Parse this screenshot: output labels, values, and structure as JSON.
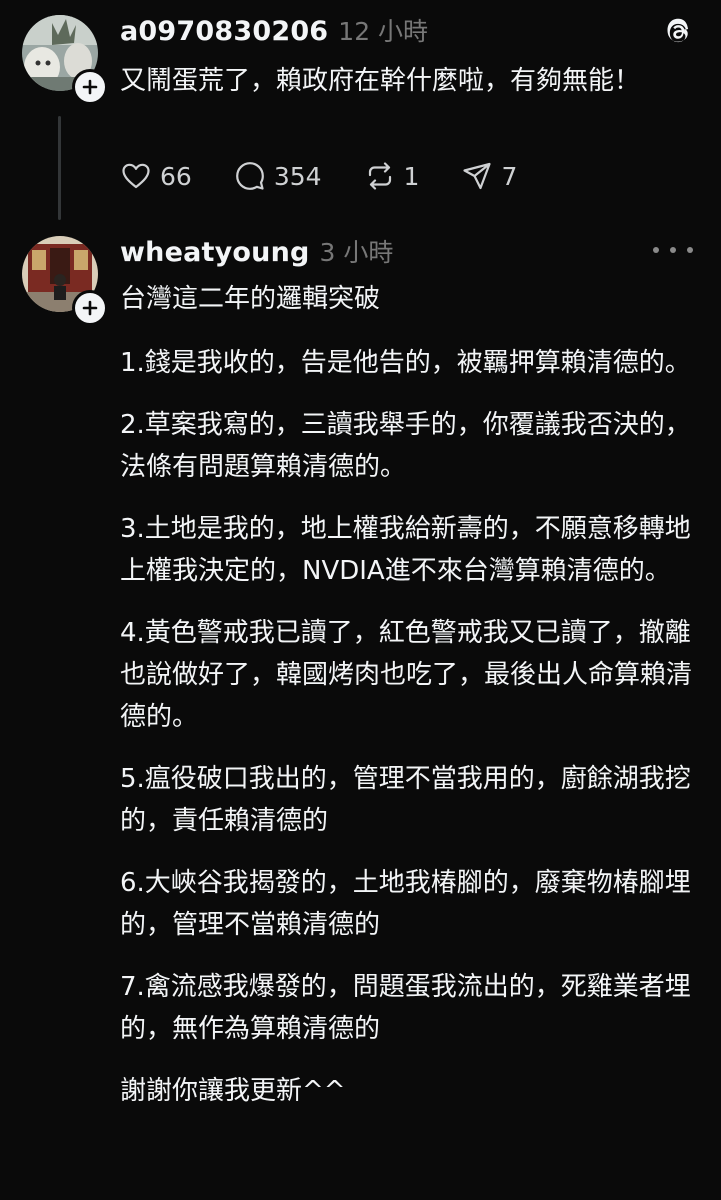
{
  "post1": {
    "username": "a0970830206",
    "timestamp": "12 小時",
    "content": "又鬧蛋荒了，賴政府在幹什麼啦，有夠無能！",
    "actions": {
      "like_count": "66",
      "reply_count": "354",
      "repost_count": "1",
      "share_count": "7"
    },
    "icons": [
      "threads-logo-icon",
      "heart-icon",
      "comment-icon",
      "repost-icon",
      "share-icon",
      "plus-icon"
    ]
  },
  "post2": {
    "username": "wheatyoung",
    "timestamp": "3 小時",
    "paragraphs": [
      "台灣這二年的邏輯突破",
      "1.錢是我收的，告是他告的，被羈押算賴清德的。",
      "2.草案我寫的，三讀我舉手的，你覆議我否決的，法條有問題算賴清德的。",
      "3.土地是我的，地上權我給新壽的，不願意移轉地上權我決定的，NVDIA進不來台灣算賴清德的。",
      "4.黃色警戒我已讀了，紅色警戒我又已讀了，撤離也說做好了，韓國烤肉也吃了，最後出人命算賴清德的。",
      "5.瘟役破口我出的，管理不當我用的，廚餘湖我挖的，責任賴清德的",
      "6.大峽谷我揭發的，土地我椿腳的，廢棄物椿腳埋的，管理不當賴清德的",
      "7.禽流感我爆發的，問題蛋我流出的，死雞業者埋的，無作為算賴清德的",
      "謝謝你讓我更新^^"
    ],
    "icons": [
      "more-options-icon",
      "plus-icon"
    ]
  },
  "colors": {
    "background": "#0a0a0a",
    "text_primary": "#f3f5f7",
    "text_secondary": "#777777",
    "thread_line": "#333638"
  }
}
